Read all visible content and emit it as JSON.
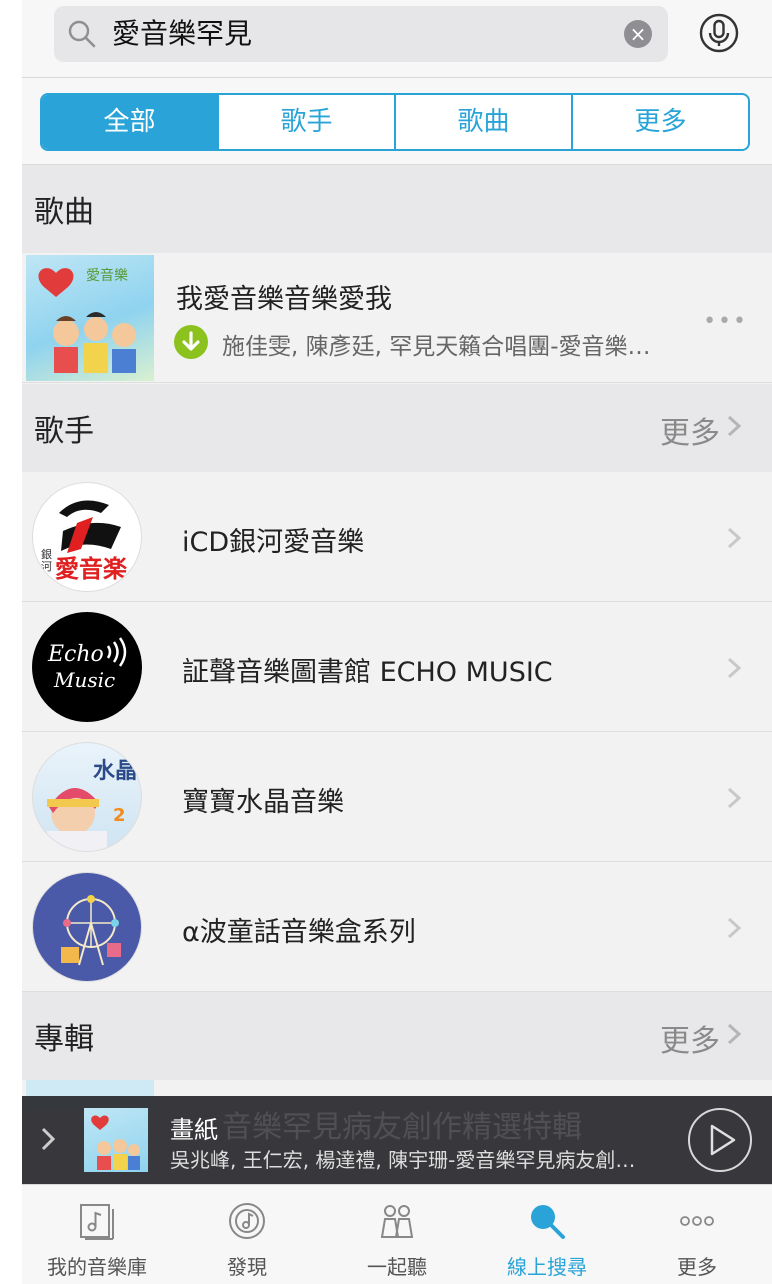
{
  "search": {
    "query": "愛音樂罕見"
  },
  "segments": [
    "全部",
    "歌手",
    "歌曲",
    "更多"
  ],
  "sections": {
    "songs": {
      "title": "歌曲"
    },
    "artists": {
      "title": "歌手",
      "more": "更多"
    },
    "albums": {
      "title": "專輯",
      "more": "更多"
    }
  },
  "song": {
    "title": "我愛音樂音樂愛我",
    "subtitle": "施佳雯, 陳彥廷, 罕見天籟合唱團-愛音樂…",
    "cover_text": "愛音樂"
  },
  "artists": [
    {
      "name": "iCD銀河愛音樂",
      "logo_text": "愛音楽",
      "logo_small": "銀河"
    },
    {
      "name": "証聲音樂圖書館 ECHO MUSIC",
      "logo_text": "Echo",
      "logo_text2": "Music"
    },
    {
      "name": "寶寶水晶音樂",
      "logo_text": "水晶",
      "logo_num": "2"
    },
    {
      "name": "α波童話音樂盒系列"
    }
  ],
  "player": {
    "title": "畫紙",
    "subtitle": "吳兆峰, 王仁宏, 楊達禮, 陳宇珊-愛音樂罕見病友創…",
    "background_title": "音樂罕見病友創作精選特輯"
  },
  "tabbar": [
    {
      "label": "我的音樂庫",
      "icon": "music-library-icon"
    },
    {
      "label": "發現",
      "icon": "discover-icon"
    },
    {
      "label": "一起聽",
      "icon": "listen-together-icon"
    },
    {
      "label": "線上搜尋",
      "icon": "search-icon",
      "active": true
    },
    {
      "label": "更多",
      "icon": "more-dots-icon"
    }
  ],
  "colors": {
    "accent": "#2aa4d8",
    "download": "#8cc21e"
  }
}
